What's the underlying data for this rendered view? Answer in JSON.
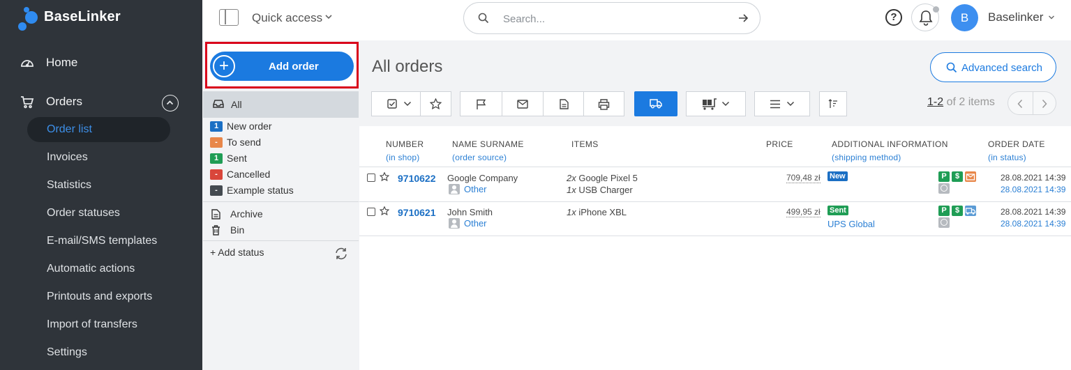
{
  "brand": {
    "name": "BaseLinker",
    "accent": "#1b7ae0"
  },
  "sidebar": {
    "home": "Home",
    "orders": "Orders",
    "items": [
      "Order list",
      "Invoices",
      "Statistics",
      "Order statuses",
      "E-mail/SMS templates",
      "Automatic actions",
      "Printouts and exports",
      "Import of transfers",
      "Settings"
    ],
    "active_index": 0
  },
  "topbar": {
    "quick_access": "Quick access",
    "search_placeholder": "Search...",
    "help": "?",
    "avatar_letter": "B",
    "user": "Baselinker"
  },
  "filters": {
    "add_order": "Add order",
    "all": "All",
    "statuses": [
      {
        "badge": "1",
        "label": "New order",
        "color": "#1b6fc4"
      },
      {
        "badge": "-",
        "label": "To send",
        "color": "#e8874a"
      },
      {
        "badge": "1",
        "label": "Sent",
        "color": "#1f9d55"
      },
      {
        "badge": "-",
        "label": "Cancelled",
        "color": "#d9463b"
      },
      {
        "badge": "-",
        "label": "Example status",
        "color": "#444a50"
      }
    ],
    "archive": "Archive",
    "bin": "Bin",
    "add_status": "+ Add status"
  },
  "main": {
    "title": "All orders",
    "advanced_search": "Advanced search",
    "pager_range": "1-2",
    "pager_rest": " of 2 items"
  },
  "table": {
    "headers": {
      "number": "NUMBER",
      "number_sub": "(in shop)",
      "name": "NAME SURNAME",
      "name_sub": "(order source)",
      "items": "ITEMS",
      "price": "PRICE",
      "info": "ADDITIONAL INFORMATION",
      "info_sub": "(shipping method)",
      "date": "ORDER DATE",
      "date_sub": "(in status)"
    },
    "rows": [
      {
        "number": "9710622",
        "name": "Google Company",
        "source": "Other",
        "items": [
          {
            "qty": "2x",
            "name": " Google Pixel 5"
          },
          {
            "qty": "1x",
            "name": " USB Charger"
          }
        ],
        "price": "709,48 zł",
        "status": "New",
        "status_color": "#1b6fc4",
        "shipping": "",
        "date": "28.08.2021 14:39",
        "status_date": "28.08.2021 14:39"
      },
      {
        "number": "9710621",
        "name": "John Smith",
        "source": "Other",
        "items": [
          {
            "qty": "1x",
            "name": " iPhone XBL"
          }
        ],
        "price": "499,95 zł",
        "status": "Sent",
        "status_color": "#1f9d55",
        "shipping": "UPS Global",
        "date": "28.08.2021 14:39",
        "status_date": "28.08.2021 14:39"
      }
    ],
    "mini_icons": {
      "p": "P",
      "s": "$"
    }
  }
}
